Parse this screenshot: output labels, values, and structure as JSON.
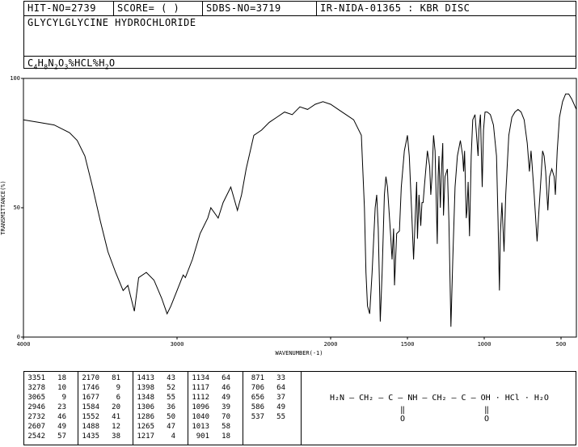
{
  "header": {
    "hit_no": "HIT-NO=2739",
    "score": "SCORE=  (   )",
    "sdbs_no": "SDBS-NO=3719",
    "method": "IR-NIDA-01365 : KBR DISC",
    "compound": "GLYCYLGLYCINE HYDROCHLORIDE",
    "formula_parts": [
      "C",
      "4",
      "H",
      "8",
      "N",
      "2",
      "O",
      "3",
      "%HCL%H",
      "2",
      "O"
    ]
  },
  "chart_data": {
    "type": "line",
    "title": "",
    "xlabel": "WAVENUMBER(-1)",
    "ylabel": "TRANSMITTANCE(%)",
    "xlim": [
      4000,
      400
    ],
    "ylim": [
      0,
      100
    ],
    "x_ticks": [
      4000,
      3000,
      2000,
      1500,
      1000,
      500
    ],
    "y_ticks": [
      0,
      50,
      100
    ],
    "x_tick_labels": [
      "4000",
      "3000",
      "2000",
      "1500",
      "1000",
      "500"
    ],
    "y_tick_labels": [
      "0",
      "50",
      "100"
    ],
    "grid": false,
    "series": [
      {
        "points": [
          [
            4000,
            84
          ],
          [
            3900,
            83
          ],
          [
            3800,
            82
          ],
          [
            3700,
            79
          ],
          [
            3650,
            76
          ],
          [
            3600,
            70
          ],
          [
            3550,
            58
          ],
          [
            3500,
            45
          ],
          [
            3450,
            33
          ],
          [
            3400,
            25
          ],
          [
            3351,
            18
          ],
          [
            3320,
            20
          ],
          [
            3278,
            10
          ],
          [
            3250,
            23
          ],
          [
            3200,
            25
          ],
          [
            3150,
            22
          ],
          [
            3100,
            15
          ],
          [
            3065,
            9
          ],
          [
            3040,
            12
          ],
          [
            3000,
            18
          ],
          [
            2960,
            24
          ],
          [
            2946,
            23
          ],
          [
            2900,
            30
          ],
          [
            2850,
            40
          ],
          [
            2800,
            46
          ],
          [
            2780,
            50
          ],
          [
            2732,
            46
          ],
          [
            2700,
            52
          ],
          [
            2650,
            58
          ],
          [
            2607,
            49
          ],
          [
            2580,
            55
          ],
          [
            2550,
            65
          ],
          [
            2500,
            78
          ],
          [
            2450,
            80
          ],
          [
            2400,
            83
          ],
          [
            2350,
            85
          ],
          [
            2300,
            87
          ],
          [
            2250,
            86
          ],
          [
            2200,
            89
          ],
          [
            2150,
            88
          ],
          [
            2100,
            90
          ],
          [
            2050,
            91
          ],
          [
            2000,
            90
          ],
          [
            1950,
            88
          ],
          [
            1900,
            86
          ],
          [
            1850,
            84
          ],
          [
            1800,
            78
          ],
          [
            1780,
            50
          ],
          [
            1770,
            25
          ],
          [
            1760,
            12
          ],
          [
            1746,
            9
          ],
          [
            1730,
            25
          ],
          [
            1710,
            50
          ],
          [
            1700,
            55
          ],
          [
            1690,
            42
          ],
          [
            1677,
            6
          ],
          [
            1665,
            25
          ],
          [
            1650,
            55
          ],
          [
            1640,
            62
          ],
          [
            1630,
            58
          ],
          [
            1610,
            40
          ],
          [
            1600,
            30
          ],
          [
            1590,
            42
          ],
          [
            1584,
            20
          ],
          [
            1570,
            40
          ],
          [
            1552,
            41
          ],
          [
            1540,
            58
          ],
          [
            1520,
            72
          ],
          [
            1500,
            78
          ],
          [
            1488,
            70
          ],
          [
            1470,
            45
          ],
          [
            1460,
            30
          ],
          [
            1440,
            60
          ],
          [
            1435,
            38
          ],
          [
            1425,
            55
          ],
          [
            1413,
            43
          ],
          [
            1405,
            52
          ],
          [
            1398,
            52
          ],
          [
            1390,
            58
          ],
          [
            1370,
            72
          ],
          [
            1355,
            66
          ],
          [
            1348,
            55
          ],
          [
            1340,
            62
          ],
          [
            1330,
            78
          ],
          [
            1320,
            72
          ],
          [
            1306,
            36
          ],
          [
            1300,
            62
          ],
          [
            1295,
            70
          ],
          [
            1286,
            50
          ],
          [
            1280,
            62
          ],
          [
            1270,
            75
          ],
          [
            1265,
            47
          ],
          [
            1255,
            62
          ],
          [
            1240,
            65
          ],
          [
            1230,
            45
          ],
          [
            1217,
            4
          ],
          [
            1205,
            30
          ],
          [
            1190,
            58
          ],
          [
            1175,
            70
          ],
          [
            1155,
            76
          ],
          [
            1140,
            70
          ],
          [
            1134,
            64
          ],
          [
            1128,
            72
          ],
          [
            1117,
            46
          ],
          [
            1112,
            49
          ],
          [
            1105,
            60
          ],
          [
            1096,
            39
          ],
          [
            1085,
            70
          ],
          [
            1075,
            84
          ],
          [
            1060,
            86
          ],
          [
            1050,
            78
          ],
          [
            1040,
            70
          ],
          [
            1035,
            80
          ],
          [
            1025,
            86
          ],
          [
            1013,
            58
          ],
          [
            1005,
            80
          ],
          [
            995,
            87
          ],
          [
            980,
            87
          ],
          [
            960,
            86
          ],
          [
            940,
            82
          ],
          [
            920,
            70
          ],
          [
            910,
            45
          ],
          [
            901,
            18
          ],
          [
            895,
            40
          ],
          [
            885,
            52
          ],
          [
            871,
            33
          ],
          [
            860,
            55
          ],
          [
            840,
            78
          ],
          [
            820,
            85
          ],
          [
            800,
            87
          ],
          [
            780,
            88
          ],
          [
            760,
            87
          ],
          [
            740,
            84
          ],
          [
            720,
            75
          ],
          [
            706,
            64
          ],
          [
            695,
            72
          ],
          [
            690,
            68
          ],
          [
            675,
            55
          ],
          [
            656,
            37
          ],
          [
            645,
            48
          ],
          [
            630,
            62
          ],
          [
            620,
            72
          ],
          [
            610,
            70
          ],
          [
            600,
            64
          ],
          [
            586,
            49
          ],
          [
            575,
            62
          ],
          [
            560,
            65
          ],
          [
            545,
            62
          ],
          [
            537,
            55
          ],
          [
            525,
            72
          ],
          [
            510,
            85
          ],
          [
            490,
            91
          ],
          [
            470,
            94
          ],
          [
            450,
            94
          ],
          [
            430,
            92
          ],
          [
            400,
            88
          ]
        ]
      }
    ],
    "peak_table": [
      [
        [
          "3351",
          "18"
        ],
        [
          "3278",
          "10"
        ],
        [
          "3065",
          "9"
        ],
        [
          "2946",
          "23"
        ],
        [
          "2732",
          "46"
        ],
        [
          "2607",
          "49"
        ],
        [
          "2542",
          "57"
        ]
      ],
      [
        [
          "2170",
          "81"
        ],
        [
          "1746",
          "9"
        ],
        [
          "1677",
          "6"
        ],
        [
          "1584",
          "20"
        ],
        [
          "1552",
          "41"
        ],
        [
          "1488",
          "12"
        ],
        [
          "1435",
          "38"
        ]
      ],
      [
        [
          "1413",
          "43"
        ],
        [
          "1398",
          "52"
        ],
        [
          "1348",
          "55"
        ],
        [
          "1306",
          "36"
        ],
        [
          "1286",
          "50"
        ],
        [
          "1265",
          "47"
        ],
        [
          "1217",
          "4"
        ]
      ],
      [
        [
          "1134",
          "64"
        ],
        [
          "1117",
          "46"
        ],
        [
          "1112",
          "49"
        ],
        [
          "1096",
          "39"
        ],
        [
          "1040",
          "70"
        ],
        [
          "1013",
          "58"
        ],
        [
          "901",
          "18"
        ]
      ],
      [
        [
          "871",
          "33"
        ],
        [
          "706",
          "64"
        ],
        [
          "656",
          "37"
        ],
        [
          "586",
          "49"
        ],
        [
          "537",
          "55"
        ]
      ]
    ]
  },
  "structure": {
    "text": "H₂N — CH₂ — C — NH — CH₂ — C — OH · HCl · H₂O",
    "carbonyl_o": "O"
  }
}
